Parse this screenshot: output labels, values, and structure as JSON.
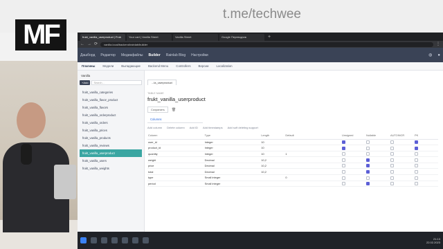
{
  "banner": {
    "channel": "t.me/techwee",
    "logo": "MF"
  },
  "browser": {
    "tabs": [
      {
        "label": "frukt_vanilla_userproduct | Fruk"
      },
      {
        "label": "Your cart | Vanilla Street"
      },
      {
        "label": "Vanilla Street"
      },
      {
        "label": "Google Переводчик"
      }
    ],
    "new_tab": "+",
    "url": "vanilla.local/backend/rainlab/builder"
  },
  "app_nav": {
    "items": [
      "Дашборд",
      "Редактор",
      "Медиафайлы",
      "Builder",
      "Rainlab Blog",
      "Настройки"
    ],
    "active_index": 3
  },
  "toolbar": {
    "items": [
      "Плагины",
      "Модели",
      "Выпадающие",
      "Backend Menu",
      "Controllers",
      "Версии",
      "Localization"
    ],
    "active_index": 0
  },
  "sidebar": {
    "title": "Vanilla",
    "add_label": "+Add",
    "search_placeholder": "Search...",
    "items": [
      "frukt_vanilla_categories",
      "frukt_vanilla_flavor_product",
      "frukt_vanilla_flavors",
      "frukt_vanilla_orderproduct",
      "frukt_vanilla_orders",
      "frukt_vanilla_prices",
      "frukt_vanilla_products",
      "frukt_vanilla_reviews",
      "frukt_vanilla_userproduct",
      "frukt_vanilla_users",
      "frukt_vanilla_weights"
    ],
    "active_index": 8
  },
  "content": {
    "doc_tab": "...la_userproduct",
    "breadcrumb": "TABLE NAME",
    "title": "frukt_vanilla_userproduct",
    "save_label": "Сохранить",
    "subtab": "Columns",
    "col_tools": [
      "Add column",
      "Delete column",
      "Add ID",
      "Add timestamps",
      "Add soft deleting support"
    ],
    "columns": [
      "Column",
      "Type",
      "Length",
      "Default",
      "Unsigned",
      "Nullable",
      "AUTOINCR",
      "PK"
    ],
    "rows": [
      {
        "name": "user_id",
        "type": "Integer",
        "length": "10",
        "def": "",
        "unsigned": true,
        "nullable": false,
        "ai": false,
        "pk": true
      },
      {
        "name": "product_id",
        "type": "Integer",
        "length": "10",
        "def": "",
        "unsigned": true,
        "nullable": false,
        "ai": false,
        "pk": true
      },
      {
        "name": "quantity",
        "type": "Integer",
        "length": "10",
        "def": "1",
        "unsigned": false,
        "nullable": false,
        "ai": false,
        "pk": false
      },
      {
        "name": "weight",
        "type": "Decimal",
        "length": "10,2",
        "def": "",
        "unsigned": false,
        "nullable": true,
        "ai": false,
        "pk": false
      },
      {
        "name": "price",
        "type": "Decimal",
        "length": "10,2",
        "def": "",
        "unsigned": false,
        "nullable": true,
        "ai": false,
        "pk": false
      },
      {
        "name": "total",
        "type": "Decimal",
        "length": "10,2",
        "def": "",
        "unsigned": false,
        "nullable": true,
        "ai": false,
        "pk": false
      },
      {
        "name": "type",
        "type": "Small integer",
        "length": "",
        "def": "0",
        "unsigned": false,
        "nullable": false,
        "ai": false,
        "pk": false
      },
      {
        "name": "period",
        "type": "Small integer",
        "length": "",
        "def": "",
        "unsigned": false,
        "nullable": true,
        "ai": false,
        "pk": false
      }
    ]
  },
  "taskbar": {
    "time": "21:13",
    "date": "22.02.2023"
  },
  "colors": {
    "accent": "#3aa6a2",
    "header": "#3a4356",
    "checkbox": "#5c5fd6"
  }
}
